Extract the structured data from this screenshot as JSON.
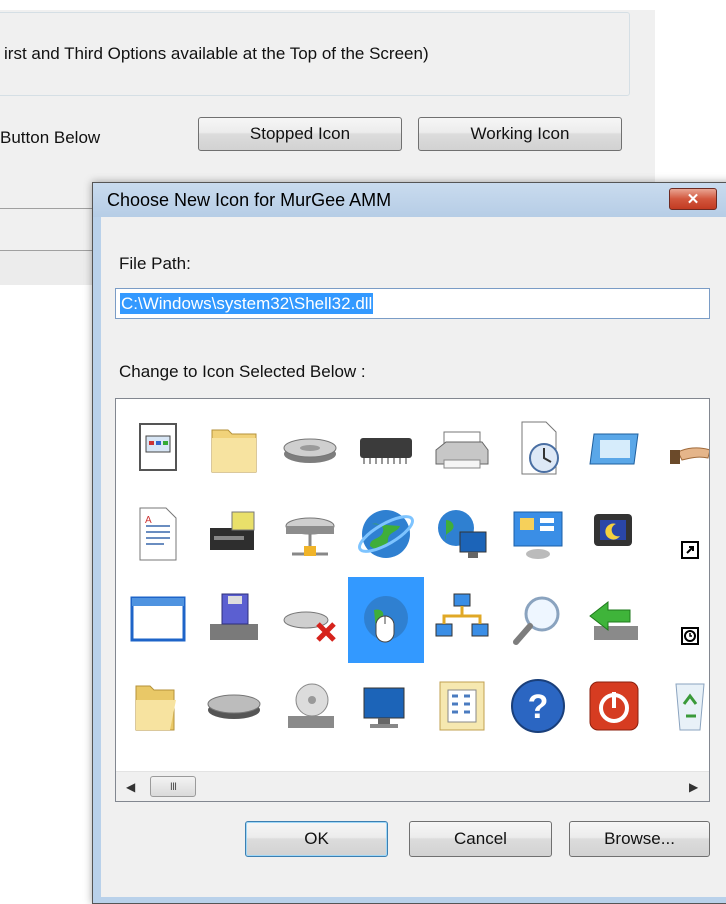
{
  "background_window": {
    "group_text": "irst and Third Options available at the Top of the Screen)",
    "button_prompt": "Button Below",
    "stopped_icon_label": "Stopped Icon",
    "working_icon_label": "Working Icon"
  },
  "dialog": {
    "title": "Choose New Icon for MurGee AMM",
    "close_glyph": "✕",
    "file_path_label": "File Path:",
    "file_path_value": "C:\\Windows\\system32\\Shell32.dll",
    "change_label": "Change to Icon Selected Below :",
    "ok_label": "OK",
    "cancel_label": "Cancel",
    "browse_label": "Browse...",
    "scroll_thumb_glyph": "III",
    "selected_icon": "globe-mouse-icon",
    "icons": [
      [
        "app-window-icon",
        "folder-icon",
        "hard-drive-icon",
        "memory-chip-icon",
        "printer-icon",
        "clock-document-icon",
        "screen-frame-icon",
        "hand-share-icon"
      ],
      [
        "text-document-icon",
        "network-drive-icon",
        "network-disk-icon",
        "globe-icon",
        "globe-monitor-icon",
        "control-panel-icon",
        "moon-screensaver-icon",
        "shortcut-overlay-icon"
      ],
      [
        "blank-window-icon",
        "floppy-drive-icon",
        "disconnected-drive-icon",
        "globe-mouse-icon",
        "network-computers-icon",
        "magnifier-icon",
        "green-arrow-drive-icon",
        "clock-overlay-icon"
      ],
      [
        "open-folder-icon",
        "flat-drive-icon",
        "cd-drive-icon",
        "desktop-computer-icon",
        "calculator-folder-icon",
        "help-icon",
        "power-icon",
        "recycle-bin-icon"
      ]
    ]
  }
}
